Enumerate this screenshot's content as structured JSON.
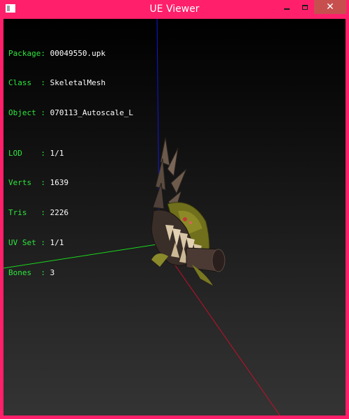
{
  "window": {
    "title": "UE Viewer",
    "close_glyph": "✕"
  },
  "colors": {
    "frame": "#ff1f6b",
    "label": "#2ee83d",
    "value": "#ffffff",
    "axis_x": "#c0102a",
    "axis_y": "#19d81c",
    "axis_z": "#1018d8"
  },
  "info": {
    "package": {
      "label": "Package:",
      "value": "00049550.upk"
    },
    "class": {
      "label": "Class  :",
      "value": "SkeletalMesh"
    },
    "object": {
      "label": "Object :",
      "value": "070113_Autoscale_L"
    },
    "lod": {
      "label": "LOD    :",
      "value": "1/1"
    },
    "verts": {
      "label": "Verts  :",
      "value": "1639"
    },
    "tris": {
      "label": "Tris   :",
      "value": "2226"
    },
    "uvset": {
      "label": "UV Set :",
      "value": "1/1"
    },
    "bones": {
      "label": "Bones  :",
      "value": "3"
    }
  },
  "icons": {
    "app": "app-icon",
    "minimize": "minimize-icon",
    "maximize": "maximize-icon",
    "close": "close-icon"
  }
}
